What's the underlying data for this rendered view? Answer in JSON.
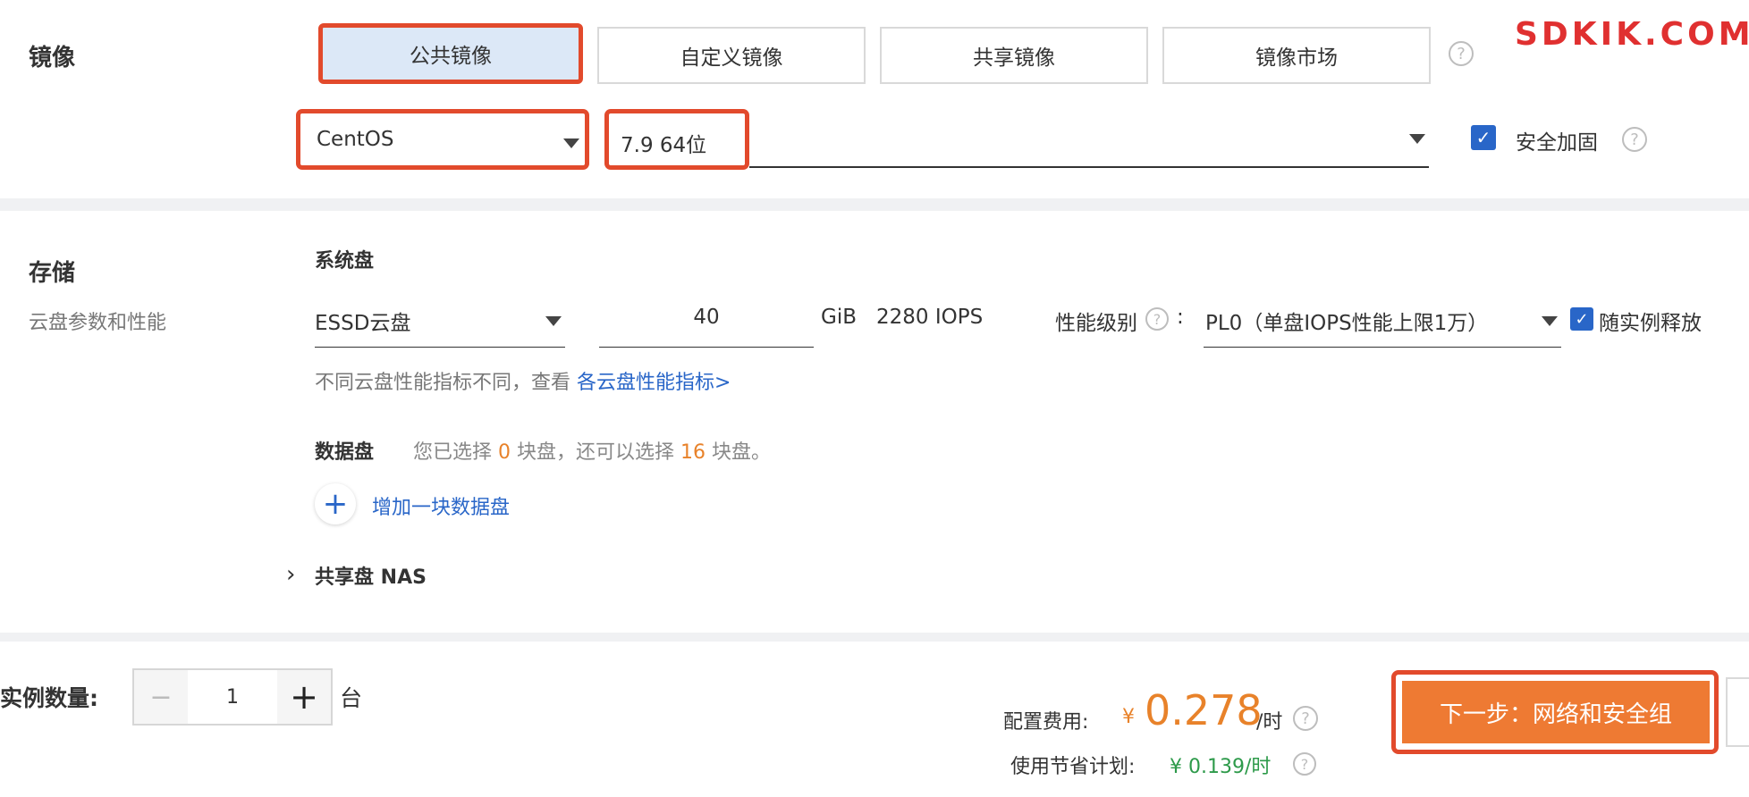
{
  "image_section": {
    "label": "镜像",
    "tabs": [
      {
        "label": "公共镜像",
        "active": true
      },
      {
        "label": "自定义镜像",
        "active": false
      },
      {
        "label": "共享镜像",
        "active": false
      },
      {
        "label": "镜像市场",
        "active": false
      }
    ],
    "help_glyph": "?",
    "os_select": {
      "value": "CentOS"
    },
    "version_select": {
      "value": "7.9 64位"
    },
    "security_hardening": {
      "label": "安全加固",
      "checked": true
    },
    "corner_text": "SDKIK.COM"
  },
  "storage_section": {
    "label": "存储",
    "sublabel": "云盘参数和性能",
    "system_disk": {
      "title": "系统盘",
      "type": "ESSD云盘",
      "size": "40",
      "unit": "GiB",
      "iops": "2280 IOPS",
      "perf_label": "性能级别",
      "perf_colon": ":",
      "perf_value": "PL0（单盘IOPS性能上限1万）",
      "release_label": "随实例释放",
      "release_checked": true,
      "hint": "不同云盘性能指标不同，查看",
      "hint_link": "各云盘性能指标>"
    },
    "data_disk": {
      "title": "数据盘",
      "text_1": "您已选择",
      "selected": "0",
      "text_2": "块盘，还可以选择",
      "remaining": "16",
      "text_3": "块盘。",
      "add_label": "增加一块数据盘"
    },
    "nas": {
      "chevron": "›",
      "label": "共享盘 NAS"
    }
  },
  "footer": {
    "quantity_label": "实例数量:",
    "quantity_minus": "−",
    "quantity_value": "1",
    "quantity_plus": "+",
    "quantity_unit": "台",
    "fee_label": "配置费用:",
    "currency": "¥",
    "price": "0.278",
    "price_unit": "/时",
    "savings_label": "使用节省计划:",
    "savings_value": "¥ 0.139/时",
    "next_button": "下一步：网络和安全组"
  },
  "colors": {
    "highlight_red": "#e24a2c",
    "accent_blue": "#2966c8",
    "price_orange": "#e8822a",
    "button_orange": "#ee7a33",
    "tab_active_bg": "#dce8f7"
  },
  "icons": {
    "help": "question-circle-icon",
    "dropdown": "caret-down-icon",
    "checkbox": "check-icon",
    "add": "plus-icon",
    "expand": "chevron-right-icon",
    "stepper_minus": "minus-icon",
    "stepper_plus": "plus-icon"
  }
}
